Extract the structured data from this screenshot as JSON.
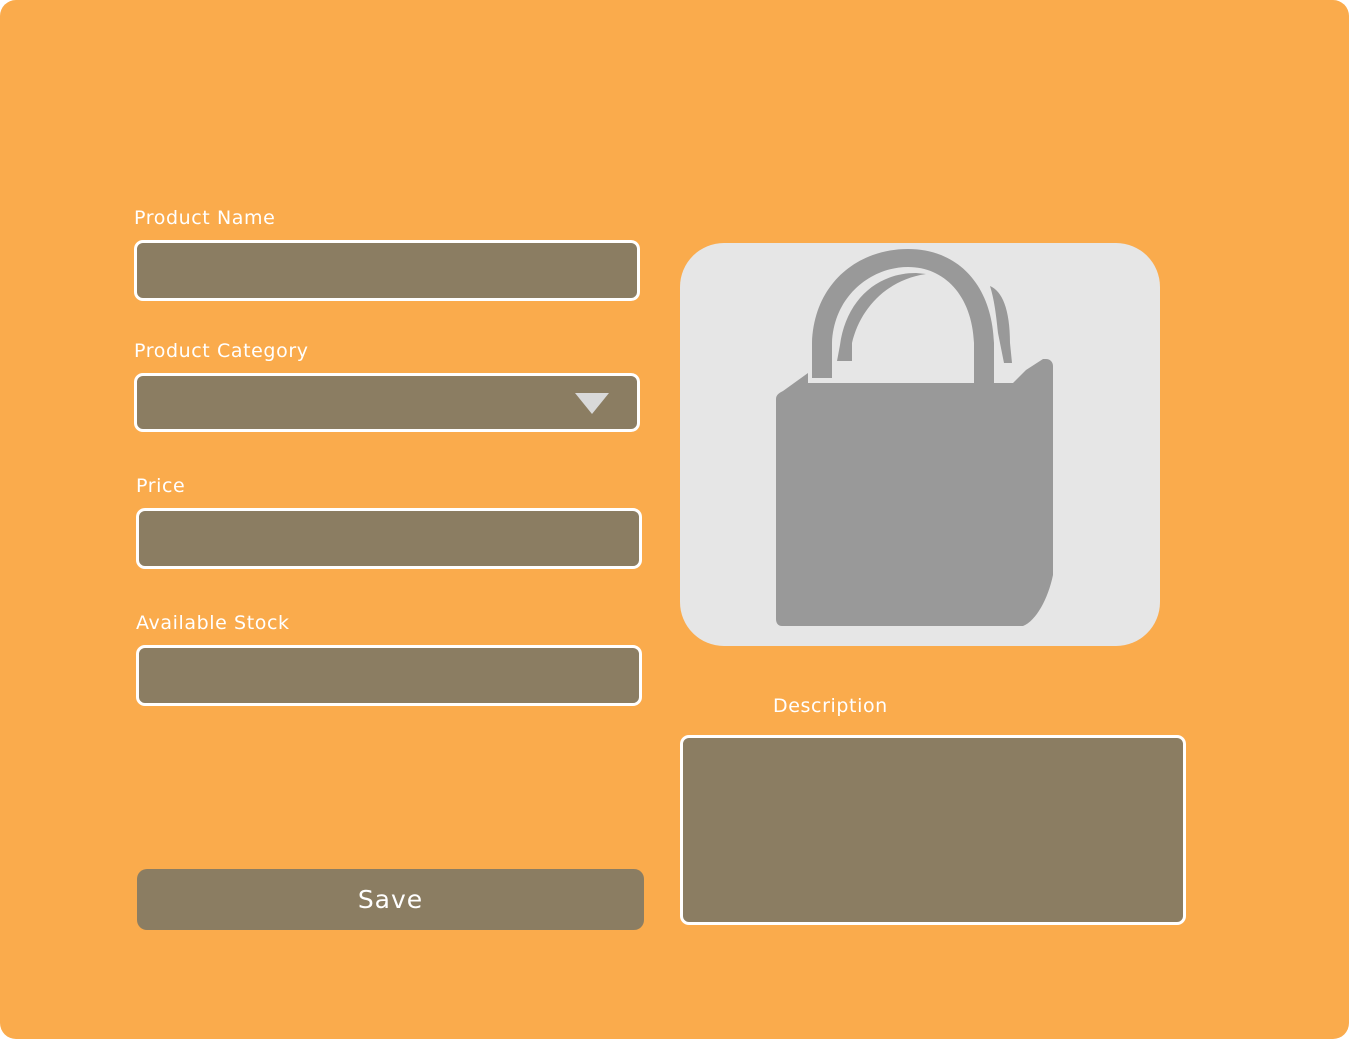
{
  "form": {
    "product_name": {
      "label": "Product Name",
      "value": ""
    },
    "product_category": {
      "label": "Product Category",
      "selected": ""
    },
    "price": {
      "label": "Price",
      "value": ""
    },
    "available_stock": {
      "label": "Available Stock",
      "value": ""
    },
    "description": {
      "label": "Description",
      "value": ""
    },
    "save_label": "Save"
  },
  "image": {
    "icon": "shopping-bag-icon"
  },
  "colors": {
    "background": "#FAAB4C",
    "field": "#8B7D62",
    "field_border": "#FFFFFF",
    "image_box": "#E6E6E6",
    "icon": "#999999"
  }
}
